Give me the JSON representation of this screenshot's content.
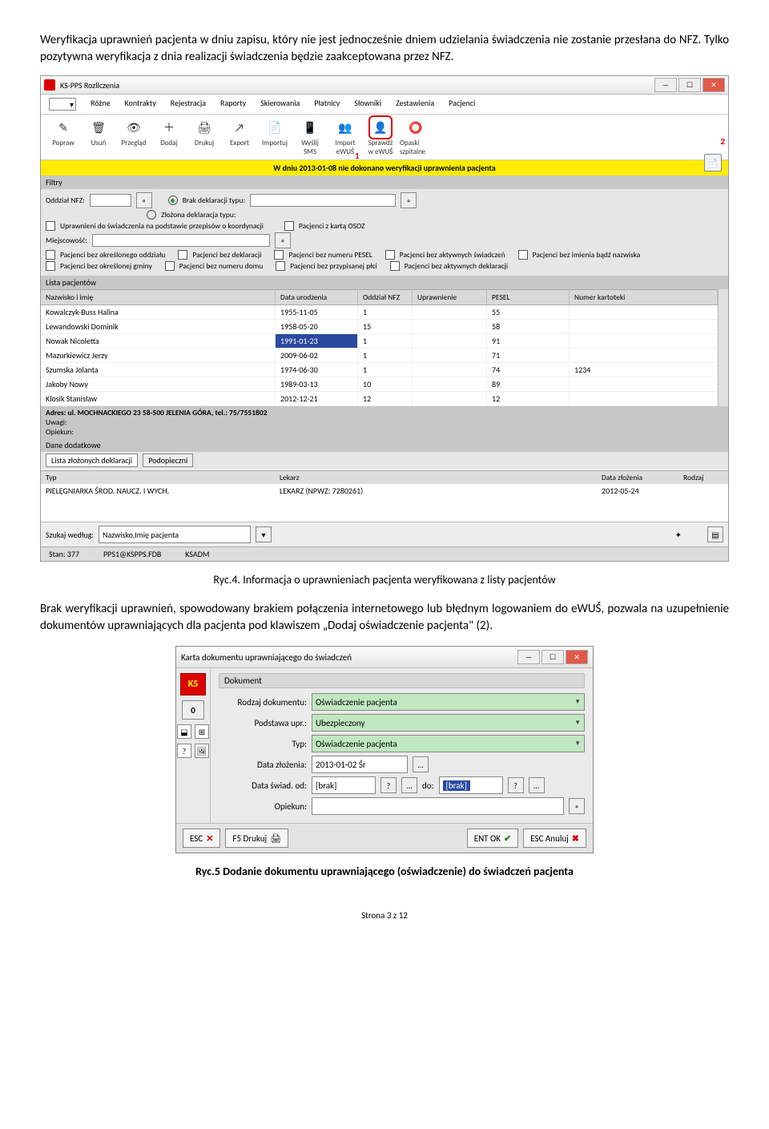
{
  "para1": "Weryfikacja uprawnień pacjenta w dniu zapisu, który nie jest jednocześnie dniem udzielania świadczenia nie zostanie przesłana do NFZ. Tylko pozytywna weryfikacja z dnia realizacji świadczenia będzie zaakceptowana przez NFZ.",
  "app": {
    "title": "KS-PPS Rozliczenia",
    "menus": [
      "Różne",
      "Kontrakty",
      "Rejestracja",
      "Raporty",
      "Skierowania",
      "Płatnicy",
      "Słowniki",
      "Zestawienia",
      "Pacjenci"
    ],
    "toolbar": [
      {
        "l1": "Popraw",
        "l2": "",
        "ico": "✎",
        "hl": false
      },
      {
        "l1": "Usuń",
        "l2": "",
        "ico": "🗑",
        "hl": false
      },
      {
        "l1": "Przegląd",
        "l2": "",
        "ico": "👁",
        "hl": false
      },
      {
        "l1": "Dodaj",
        "l2": "",
        "ico": "＋",
        "hl": false
      },
      {
        "l1": "Drukuj",
        "l2": "",
        "ico": "🖨",
        "hl": false
      },
      {
        "l1": "Export",
        "l2": "",
        "ico": "↗",
        "hl": false
      },
      {
        "l1": "Importuj",
        "l2": "",
        "ico": "📄",
        "hl": false
      },
      {
        "l1": "Wyślij",
        "l2": "SMS",
        "ico": "📱",
        "hl": false
      },
      {
        "l1": "Import",
        "l2": "eWUŚ",
        "ico": "👥",
        "hl": false
      },
      {
        "l1": "Sprawdź",
        "l2": "w eWUŚ",
        "ico": "👤",
        "hl": true
      },
      {
        "l1": "Opaski szpitalne",
        "l2": "",
        "ico": "⭕",
        "hl": false
      }
    ],
    "labels": {
      "n1": "1",
      "n2": "2"
    },
    "yellow": "W dniu 2013-01-08 nie dokonano weryfikacji uprawnienia pacjenta",
    "filtry": "Filtry",
    "f_oddzial": "Oddział NFZ:",
    "f_brak": "Brak deklaracji typu:",
    "f_zloz": "Złożona deklaracja typu:",
    "f_upraw": "Uprawnieni do świadczenia na podstawie przepisów o koordynacji",
    "f_osoz": "Pacjenci z kartą OSOZ",
    "f_miejsc": "Miejscowość:",
    "f_row3": [
      "Pacjenci bez określonego oddziału",
      "Pacjenci bez deklaracji",
      "Pacjenci bez numeru PESEL",
      "Pacjenci bez aktywnych świadczeń",
      "Pacjenci bez imienia bądź nazwiska"
    ],
    "f_row4": [
      "Pacjenci bez określonej gminy",
      "Pacjenci bez numeru domu",
      "Pacjenci bez przypisanej płci",
      "Pacjenci bez aktywnych deklaracji"
    ],
    "listhdr": "Lista pacjentów",
    "cols": [
      "Nazwisko i imię",
      "Data urodzenia",
      "Oddział NFZ",
      "Uprawnienie",
      "PESEL",
      "Numer kartoteki"
    ],
    "rows": [
      [
        "Kowalczyk-Buss Halina",
        "1955-11-05",
        "1",
        "",
        "55",
        ""
      ],
      [
        "Lewandowski Dominik",
        "1958-05-20",
        "15",
        "",
        "58",
        ""
      ],
      [
        "Nowak  Nicoletta",
        "1991-01-23",
        "1",
        "",
        "91",
        ""
      ],
      [
        "Mazurkiewicz Jerzy",
        "2009-06-02",
        "1",
        "",
        "71",
        ""
      ],
      [
        "Szumska Jolanta",
        "1974-06-30",
        "1",
        "",
        "74",
        "1234"
      ],
      [
        "Jakoby Nowy",
        "1989-03-13",
        "10",
        "",
        "89",
        ""
      ],
      [
        "Klosik Stanisław",
        "2012-12-21",
        "12",
        "",
        "12",
        ""
      ]
    ],
    "addr": "Adres: ul. MOCHNACKIEGO 23 58-500 JELENIA GÓRA, tel.: 75/7551802",
    "addr2": "Uwagi:",
    "addr3": "Opiekun:",
    "dane": "Dane dodatkowe",
    "tabs": [
      "Lista złożonych deklaracji",
      "Podopieczni"
    ],
    "dcols": [
      "Typ",
      "Lekarz",
      "Data złożenia",
      "Rodzaj"
    ],
    "drow": [
      "PIELĘGNIARKA ŚROD. NAUCZ. I WYCH.",
      "LEKARZ  (NPWZ: 7280261)",
      "2012-05-24",
      ""
    ],
    "search_label": "Szukaj według:",
    "search_value": "Nazwisko,Imię pacjenta",
    "status": {
      "stan": "Stan: 377",
      "db": "PPS1@KSPPS.FDB",
      "user": "KSADM"
    }
  },
  "fig4": "Ryc.4. Informacja o uprawnieniach pacjenta weryfikowana z listy pacjentów",
  "para2": "Brak weryfikacji uprawnień, spowodowany brakiem połączenia internetowego lub błędnym logowaniem do eWUŚ, pozwala na uzupełnienie dokumentów uprawniających dla pacjenta pod klawiszem „Dodaj oświadczenie pacjenta\" (2).",
  "dlg": {
    "title": "Karta dokumentu uprawniającego do świadczeń",
    "section": "Dokument",
    "num": "0",
    "rows": {
      "rodzaj": {
        "label": "Rodzaj dokumentu:",
        "value": "Oświadczenie pacjenta"
      },
      "podstawa": {
        "label": "Podstawa upr.:",
        "value": "Ubezpieczony"
      },
      "typ": {
        "label": "Typ:",
        "value": "Oświadczenie pacjenta"
      },
      "data_zloz": {
        "label": "Data złożenia:",
        "value": "2013-01-02  Śr"
      },
      "data_swiad": {
        "label": "Data świad. od:",
        "v1": "[brak]",
        "mid": "do:",
        "v2": "[brak]"
      },
      "opiekun": {
        "label": "Opiekun:",
        "value": ""
      }
    },
    "buttons": {
      "esc": "ESC",
      "f5": "F5 Drukuj",
      "ent": "ENT OK",
      "anul": "ESC Anuluj"
    }
  },
  "fig5": "Ryc.5 Dodanie dokumentu uprawniającego (oświadczenie) do świadczeń pacjenta",
  "pageno": "Strona 3 z 12"
}
